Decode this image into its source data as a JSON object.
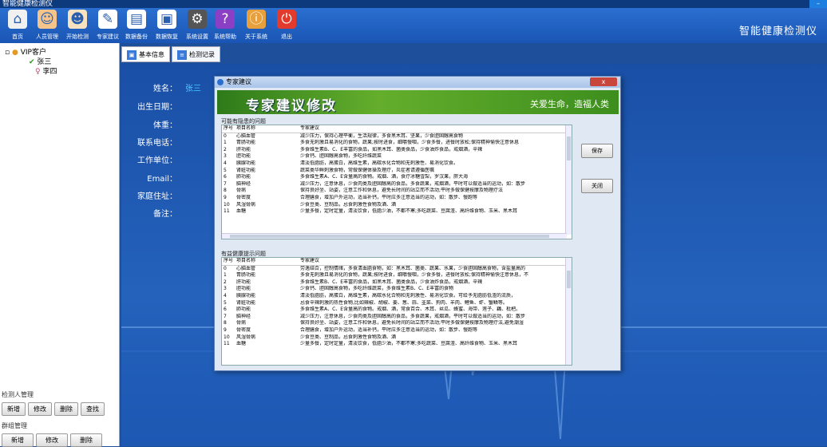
{
  "app": {
    "title": "智能健康检测仪",
    "brand": "智能健康检测仪"
  },
  "toolbar": {
    "items": [
      {
        "label": "首页",
        "icon": "home-icon",
        "color": "#f0f0f0"
      },
      {
        "label": "人员管理",
        "icon": "user-icon",
        "color": "#f4c48a"
      },
      {
        "label": "开始检测",
        "icon": "doctor-icon",
        "color": "#f8e2c0"
      },
      {
        "label": "专家建议",
        "icon": "edit-document-icon",
        "color": "#ffffff"
      },
      {
        "label": "数据备份",
        "icon": "backup-icon",
        "color": "#ffffff"
      },
      {
        "label": "数据恢复",
        "icon": "save-disk-icon",
        "color": "#ffffff"
      },
      {
        "label": "系统设置",
        "icon": "settings-icon",
        "color": "#555555"
      },
      {
        "label": "系统帮助",
        "icon": "help-icon",
        "color": "#8a3fc4"
      },
      {
        "label": "关于系统",
        "icon": "about-icon",
        "color": "#e8a03c"
      },
      {
        "label": "退出",
        "icon": "power-icon",
        "color": "#e23b2e"
      }
    ]
  },
  "tree": {
    "root": "VIP客户",
    "children": [
      "张三",
      "李四"
    ]
  },
  "left_panel": {
    "people_group": {
      "title": "检测人管理",
      "buttons": [
        "新增",
        "修改",
        "删除",
        "查找"
      ]
    },
    "group_group": {
      "title": "群组管理",
      "buttons": [
        "新增",
        "修改",
        "删除"
      ]
    }
  },
  "tabs": [
    "基本信息",
    "检测记录"
  ],
  "form": {
    "labels": [
      "姓名：",
      "出生日期：",
      "体重：",
      "联系电话：",
      "工作单位：",
      "Email：",
      "家庭住址：",
      "备注："
    ],
    "name_value": "张三"
  },
  "dialog": {
    "title": "专家建议",
    "close": "x",
    "banner_title": "专家建议修改",
    "banner_slogan": "关爱生命，造福人类",
    "section1_title": "可能有隐患的问题",
    "section2_title": "有益健康提示问题",
    "columns": [
      "序号",
      "项目名称",
      "专家建议"
    ],
    "save_button": "保存",
    "close_button": "关闭",
    "grid1": [
      [
        "0",
        "心脑血管",
        "减少压力，保持心理平衡，生活规律，多食黑木耳、坚果，少食胆固醇高食物"
      ],
      [
        "1",
        "胃肠功能",
        "多食无刺激且易消化的食物，蔬果;按时进食，细嚼慢咽，少食多餐，进餐时放松;保持精神愉快注意休息"
      ],
      [
        "2",
        "肝功能",
        "多食维生素B、C、E丰富的食品，如黑木耳、菌类食品，少食油炸食品，戒烟酒，辛辣"
      ],
      [
        "3",
        "胆功能",
        "少食钙、胆固醇高食物，多吃纤维蔬菜"
      ],
      [
        "4",
        "胰腺功能",
        "清淡低脂肪，高蛋白，高维生素，高碳水化合物和无刺激性、易消化饮食。"
      ],
      [
        "5",
        "肾脏功能",
        "蔬菜类华鲜刺激食物，常做保健体操及理疗，炎症者请遵循医嘱"
      ],
      [
        "6",
        "肺功能",
        "多食维生素A、C、E含量高的食物。戒烟、酒，食疗冰糖雪梨，罗汉果，胖大海"
      ],
      [
        "7",
        "脑神经",
        "减少压力，注意休息，少食肉类及胆固醇高的食品，多食蔬果，戒烟酒，平时可以做适当的运动，如：散步"
      ],
      [
        "8",
        "骨病",
        "保持良好坐、站姿，注意工作和休息，避免长时间的站立而不活动;平时多做保健按摩及物理疗法"
      ],
      [
        "9",
        "骨密度",
        "合理膳食，增加户外运动，适当补钙，平时应多注意适当的运动，如：散步、慢跑等"
      ],
      [
        "10",
        "风湿骨病",
        "少食豆类、豆制品，忌食刺激性食物及酒、酒"
      ],
      [
        "11",
        "血糖",
        "少量多餐，定时定量，清淡饮食，低脂少油，不都不寒;多吃蔬菜、豆腐渣、高纤维食物、玉米、黑木耳"
      ]
    ],
    "grid2": [
      [
        "0",
        "心脑血管",
        "劳逸结合，控制情绪，多食清血脂食物，如：黑木耳、菌类、蔬果、水果，少食胆固醇高食物，含盐量高的"
      ],
      [
        "1",
        "胃肠功能",
        "多食无刺激且易消化的食物，蔬果;按时进食，细嚼慢咽，少食多餐，进餐时放松;保持精神愉快注意休息，不"
      ],
      [
        "2",
        "肝功能",
        "多食维生素B、C、E丰富的食品，如黑木耳、菌类食品，少食油炸食品，戒烟酒，辛辣"
      ],
      [
        "3",
        "胆功能",
        "少食钙、胆固醇高食物，多吃纤维蔬菜，多食维生素B、C、E丰富的食物"
      ],
      [
        "4",
        "胰腺功能",
        "清淡低脂肪，高蛋白，高维生素，高碳水化合物和无刺激性、易消化饮食。可给予无脂肪低渣的流质，"
      ],
      [
        "5",
        "肾脏功能",
        "忌食辛辣刺激的热性食物,比如辣椒、胡椒、姜、葱、蒜、韭菜、狗肉、羊肉、鲤鱼、虾、蟹鳞等。"
      ],
      [
        "6",
        "肺功能",
        "多食维生素A、C、E含量高的食物。戒烟、酒，常食百合、木耳、丝瓜、蜂蜜、海带、莲子、藕、枇杷。"
      ],
      [
        "7",
        "脑神经",
        "减少压力，注意休息，少食肉类及胆固醇高的食品，多食蔬果，戒烟酒，平时可以做适当的运动，如：散步"
      ],
      [
        "8",
        "骨病",
        "保持良好坐、站姿，注意工作和休息，避免长时间的站立而不活动;平时多做保健按摩及物理疗法,避免潮湿"
      ],
      [
        "9",
        "骨密度",
        "合理膳食，增加户外运动，适当补钙，平时应多注意适当的运动，如：散步、慢跑等"
      ],
      [
        "10",
        "风湿骨病",
        "少食豆类、豆制品，忌食刺激性食物及酒、酒"
      ],
      [
        "11",
        "血糖",
        "少量多餐，定时定量，清淡饮食，低脂少油，不都不寒;多吃蔬菜、豆腐渣、高纤维食物、玉米、黑木耳"
      ]
    ]
  }
}
